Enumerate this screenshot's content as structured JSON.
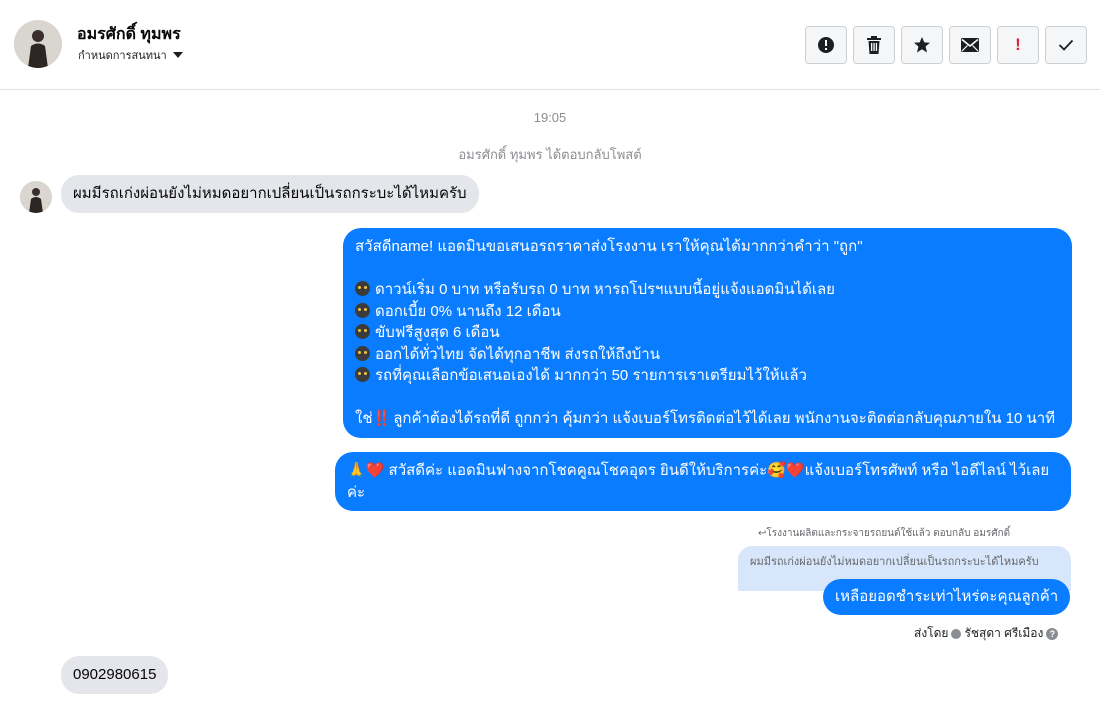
{
  "header": {
    "name": "อมรศักดิ์ ทุมพร",
    "subtitle": "กำหนดการสนทนา",
    "actions": [
      {
        "name": "alert-icon"
      },
      {
        "name": "trash-icon"
      },
      {
        "name": "star-icon"
      },
      {
        "name": "envelope-icon"
      },
      {
        "name": "exclamation-icon",
        "label": "!"
      },
      {
        "name": "check-icon"
      }
    ]
  },
  "thread": {
    "timestamp": "19:05",
    "system_note": "อมรศักดิ์ ทุมพร ได้ตอบกลับโพสต์",
    "msg_in_1": "ผมมีรถเก่งผ่อนยังไม่หมดอยากเปลี่ยนเป็นรถกระบะได้ไหมครับ",
    "msg_out_1": {
      "greeting": "สวัสดีname! แอดมินขอเสนอรถราคาส่งโรงงาน เราให้คุณได้มากกว่าคำว่า \"ถูก\"",
      "bullets": [
        "ดาวน์เริ่ม 0 บาท หรือรับรถ 0 บาท หารถโปรฯแบบนี้อยู่แจ้งแอดมินได้เลย",
        "ดอกเบี้ย 0% นานถึง 12 เดือน",
        "ขับฟรีสูงสุด 6 เดือน",
        "ออกได้ทั่วไทย จัดได้ทุกอาชีพ ส่งรถให้ถึงบ้าน",
        "รถที่คุณเลือกข้อเสนอเองได้ มากกว่า 50 รายการเราเตรียมไว้ให้แล้ว"
      ],
      "closing_prefix": "ใช่",
      "closing_emoji": "‼️",
      "closing": "ลูกค้าต้องได้รถที่ดี ถูกกว่า คุ้มกว่า แจ้งเบอร์โทรติดต่อไว้ได้เลย พนักงานจะติดต่อกลับคุณภายใน 10 นาที"
    },
    "msg_out_2": {
      "prefix_emoji": "🙏",
      "heart": "❤️",
      "text_a": "สวัสดีค่ะ แอดมินฟางจากโชคคูณโชคอุดร ยินดีให้บริการค่ะ",
      "face_emoji": "🥰",
      "text_b": "แจ้งเบอร์โทรศัพท์ หรือ ไอดีไลน์  ไว้เลย",
      "text_c": "ค่ะ"
    },
    "reply_meta": "↩โรงงานผลิตและกระจายรถยนต์ใช้แล้ว ตอบกลับ อมรศักดิ์",
    "quoted_text": "ผมมีรถเก่งผ่อนยังไม่หมดอยากเปลี่ยนเป็นรถกระบะได้ไหมครับ",
    "msg_out_3": "เหลือยอดชำระเท่าไหร่คะคุณลูกค้า",
    "sent_by_label": "ส่งโดย",
    "sent_by_name": "รัชสุดา ศรีเมือง",
    "msg_in_2": "0902980615"
  },
  "colors": {
    "outgoing_bubble": "#0a7cff",
    "incoming_bubble": "#e4e6eb",
    "quoted_bubble": "#d7e6fb",
    "alert_red": "#e41e3f"
  }
}
